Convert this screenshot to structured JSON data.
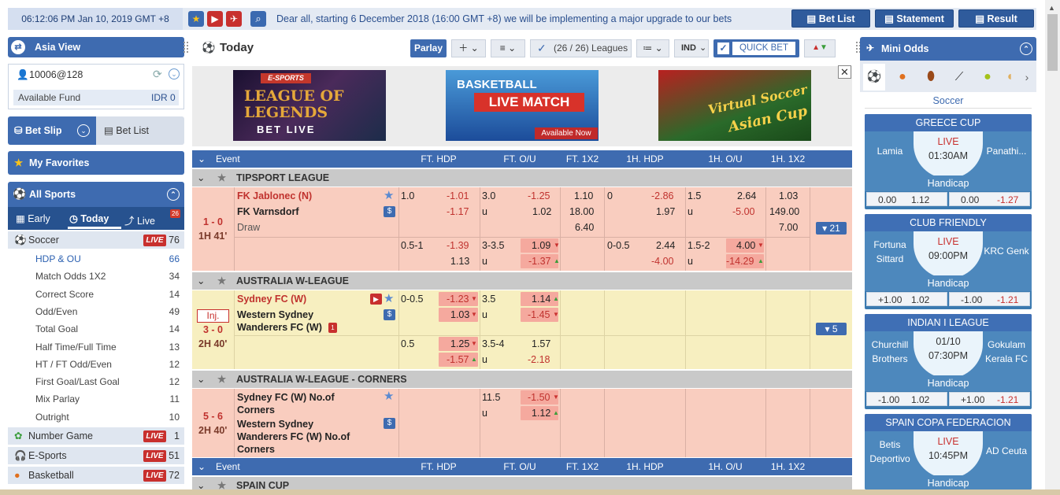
{
  "topbar": {
    "datetime": "06:12:06 PM Jan 10, 2019 GMT +8",
    "marquee": "Dear all, starting 6 December 2018 (16:00 GMT +8) we will be implementing a major upgrade to our bets",
    "bet_list": "Bet List",
    "statement": "Statement",
    "result": "Result",
    "icons": [
      "star-icon",
      "play-icon",
      "rocket-icon",
      "search-icon"
    ]
  },
  "sidebar": {
    "asia_view": "Asia View",
    "username": "10006@128",
    "available_fund_label": "Available Fund",
    "available_fund_value": "IDR 0",
    "bet_slip": "Bet Slip",
    "bet_list": "Bet List",
    "my_favorites": "My Favorites",
    "all_sports": "All Sports",
    "time_tabs": {
      "early": "Early",
      "today": "Today",
      "live": "Live",
      "live_count": "26"
    },
    "live_label": "LIVE",
    "soccer": {
      "label": "Soccer",
      "count": "76"
    },
    "sub_items": [
      {
        "label": "HDP & OU",
        "count": "66"
      },
      {
        "label": "Match Odds 1X2",
        "count": "34"
      },
      {
        "label": "Correct Score",
        "count": "14"
      },
      {
        "label": "Odd/Even",
        "count": "49"
      },
      {
        "label": "Total Goal",
        "count": "14"
      },
      {
        "label": "Half Time/Full Time",
        "count": "13"
      },
      {
        "label": "HT / FT Odd/Even",
        "count": "12"
      },
      {
        "label": "First Goal/Last Goal",
        "count": "12"
      },
      {
        "label": "Mix Parlay",
        "count": "11"
      },
      {
        "label": "Outright",
        "count": "10"
      }
    ],
    "other_sports": [
      {
        "label": "Number Game",
        "count": "1"
      },
      {
        "label": "E-Sports",
        "count": "51"
      },
      {
        "label": "Basketball",
        "count": "72"
      }
    ]
  },
  "center": {
    "title": "Today",
    "parlay": "Parlay",
    "leagues_filter": "(26 / 26) Leagues",
    "odds_type": "IND",
    "quick_bet": "QUICK BET",
    "banners": [
      {
        "line1": "E-SPORTS",
        "line2": "LEAGUE OF",
        "line3": "LEGENDS",
        "line4": "BET LIVE"
      },
      {
        "line1": "BASKETBALL",
        "line2": "LIVE MATCH",
        "line3": "Available Now"
      },
      {
        "line1": "Virtual Soccer",
        "line2": "Asian Cup"
      }
    ],
    "columns": [
      "Event",
      "FT. HDP",
      "FT. O/U",
      "FT. 1X2",
      "1H. HDP",
      "1H. O/U",
      "1H. 1X2"
    ],
    "leagues": [
      {
        "name": "TIPSPORT LEAGUE"
      },
      {
        "name": "AUSTRALIA W-LEAGUE"
      },
      {
        "name": "AUSTRALIA W-LEAGUE - CORNERS"
      },
      {
        "name": "SPAIN CUP"
      }
    ],
    "m1": {
      "score": "1 - 0",
      "time": "1H 41'",
      "home": "FK Jablonec (N)",
      "away": "FK Varnsdorf",
      "draw": "Draw",
      "more": "21",
      "r1": {
        "hdp": "1.0",
        "hdp_h": "-1.01",
        "hdp_a": "-1.17",
        "ou": "3.0",
        "ou_o": "-1.25",
        "ou_u": "1.02",
        "u": "u",
        "x1": "1.10",
        "x2": "18.00",
        "xd": "6.40",
        "h1hdp": "0",
        "h1_h": "-2.86",
        "h1_a": "1.97",
        "h1ou": "1.5",
        "h1ou_o": "2.64",
        "h1ou_u": "-5.00",
        "h1x1": "1.03",
        "h1x2": "149.00",
        "h1xd": "7.00"
      },
      "r2": {
        "hdp": "0.5-1",
        "hdp_h": "-1.39",
        "hdp_a": "1.13",
        "ou": "3-3.5",
        "ou_o": "1.09",
        "ou_u": "-1.37",
        "u": "u",
        "h1hdp": "0-0.5",
        "h1_h": "2.44",
        "h1_a": "-4.00",
        "h1ou": "1.5-2",
        "h1ou_o": "4.00",
        "h1ou_u": "-14.29"
      }
    },
    "m2": {
      "inj": "Inj.",
      "score": "3 - 0",
      "time": "2H 40'",
      "home": "Sydney FC (W)",
      "away1": "Western Sydney",
      "away2": "Wanderers FC (W)",
      "more": "5",
      "r1": {
        "hdp": "0-0.5",
        "hdp_h": "-1.23",
        "hdp_a": "1.03",
        "ou": "3.5",
        "ou_o": "1.14",
        "ou_u": "-1.45",
        "u": "u"
      },
      "r2": {
        "hdp": "0.5",
        "hdp_h": "1.25",
        "hdp_a": "-1.57",
        "ou": "3.5-4",
        "ou_o": "1.57",
        "ou_u": "-2.18",
        "u": "u"
      }
    },
    "m3": {
      "score": "5 - 6",
      "time": "2H 40'",
      "home1": "Sydney FC (W) No.of",
      "home2": "Corners",
      "away1": "Western Sydney",
      "away2": "Wanderers FC (W) No.of",
      "away3": "Corners",
      "r1": {
        "ou": "11.5",
        "ou_o": "-1.50",
        "ou_u": "1.12",
        "u": "u"
      }
    }
  },
  "right": {
    "title": "Mini Odds",
    "sport": "Soccer",
    "handicap": "Handicap",
    "cards": [
      {
        "league": "GREECE CUP",
        "home": "Lamia",
        "away": "Panathi...",
        "status": "LIVE",
        "time": "01:30AM",
        "h_line": "0.00",
        "h_odd": "1.12",
        "a_line": "0.00",
        "a_odd": "-1.27"
      },
      {
        "league": "CLUB FRIENDLY",
        "home": "Fortuna Sittard",
        "away": "KRC Genk",
        "status": "LIVE",
        "time": "09:00PM",
        "h_line": "+1.00",
        "h_odd": "1.02",
        "a_line": "-1.00",
        "a_odd": "-1.21"
      },
      {
        "league": "INDIAN I LEAGUE",
        "home": "Churchill Brothers",
        "away": "Gokulam Kerala FC",
        "status": "01/10",
        "time": "07:30PM",
        "h_line": "-1.00",
        "h_odd": "1.02",
        "a_line": "+1.00",
        "a_odd": "-1.21"
      },
      {
        "league": "SPAIN COPA FEDERACION",
        "home": "Betis Deportivo",
        "away": "AD Ceuta",
        "status": "LIVE",
        "time": "10:45PM"
      }
    ]
  },
  "colors": {
    "primary": "#3e6bb0",
    "live": "#c8302e",
    "row_live": "#f9cdbf",
    "row_inj": "#f7efc0",
    "league_bar": "#c9c9c9"
  }
}
